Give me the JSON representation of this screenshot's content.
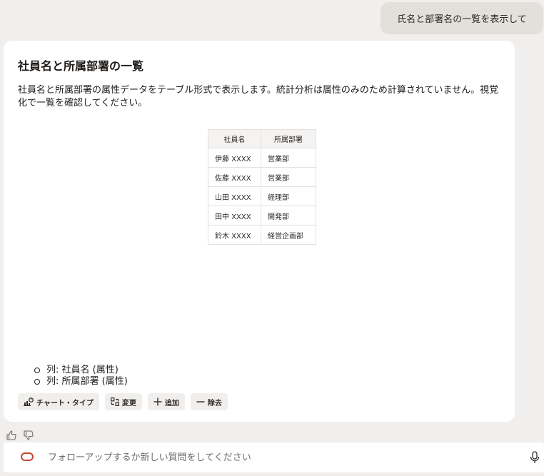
{
  "user_message": "氏名と部署名の一覧を表示して",
  "response": {
    "title": "社員名と所属部署の一覧",
    "description": "社員名と所属部署の属性データをテーブル形式で表示します。統計分析は属性のみのため計算されていません。視覚化で一覧を確認してください。",
    "table": {
      "headers": [
        "社員名",
        "所属部署"
      ],
      "rows": [
        [
          "伊藤 XXXX",
          "営業部"
        ],
        [
          "佐藤 XXXX",
          "営業部"
        ],
        [
          "山田 XXXX",
          "経理部"
        ],
        [
          "田中 XXXX",
          "開発部"
        ],
        [
          "鈴木 XXXX",
          "経営企画部"
        ]
      ]
    },
    "columns_list": [
      "列: 社員名 (属性)",
      "列: 所属部署 (属性)"
    ],
    "actions": {
      "chart_type": "チャート・タイプ",
      "change": "変更",
      "add": "追加",
      "remove": "除去"
    }
  },
  "composer": {
    "placeholder": "フォローアップするか新しい質問をしてください"
  },
  "colors": {
    "background": "#f1efed",
    "user_bubble": "#e3dfdb",
    "card": "#ffffff",
    "brand_red": "#c74634"
  }
}
